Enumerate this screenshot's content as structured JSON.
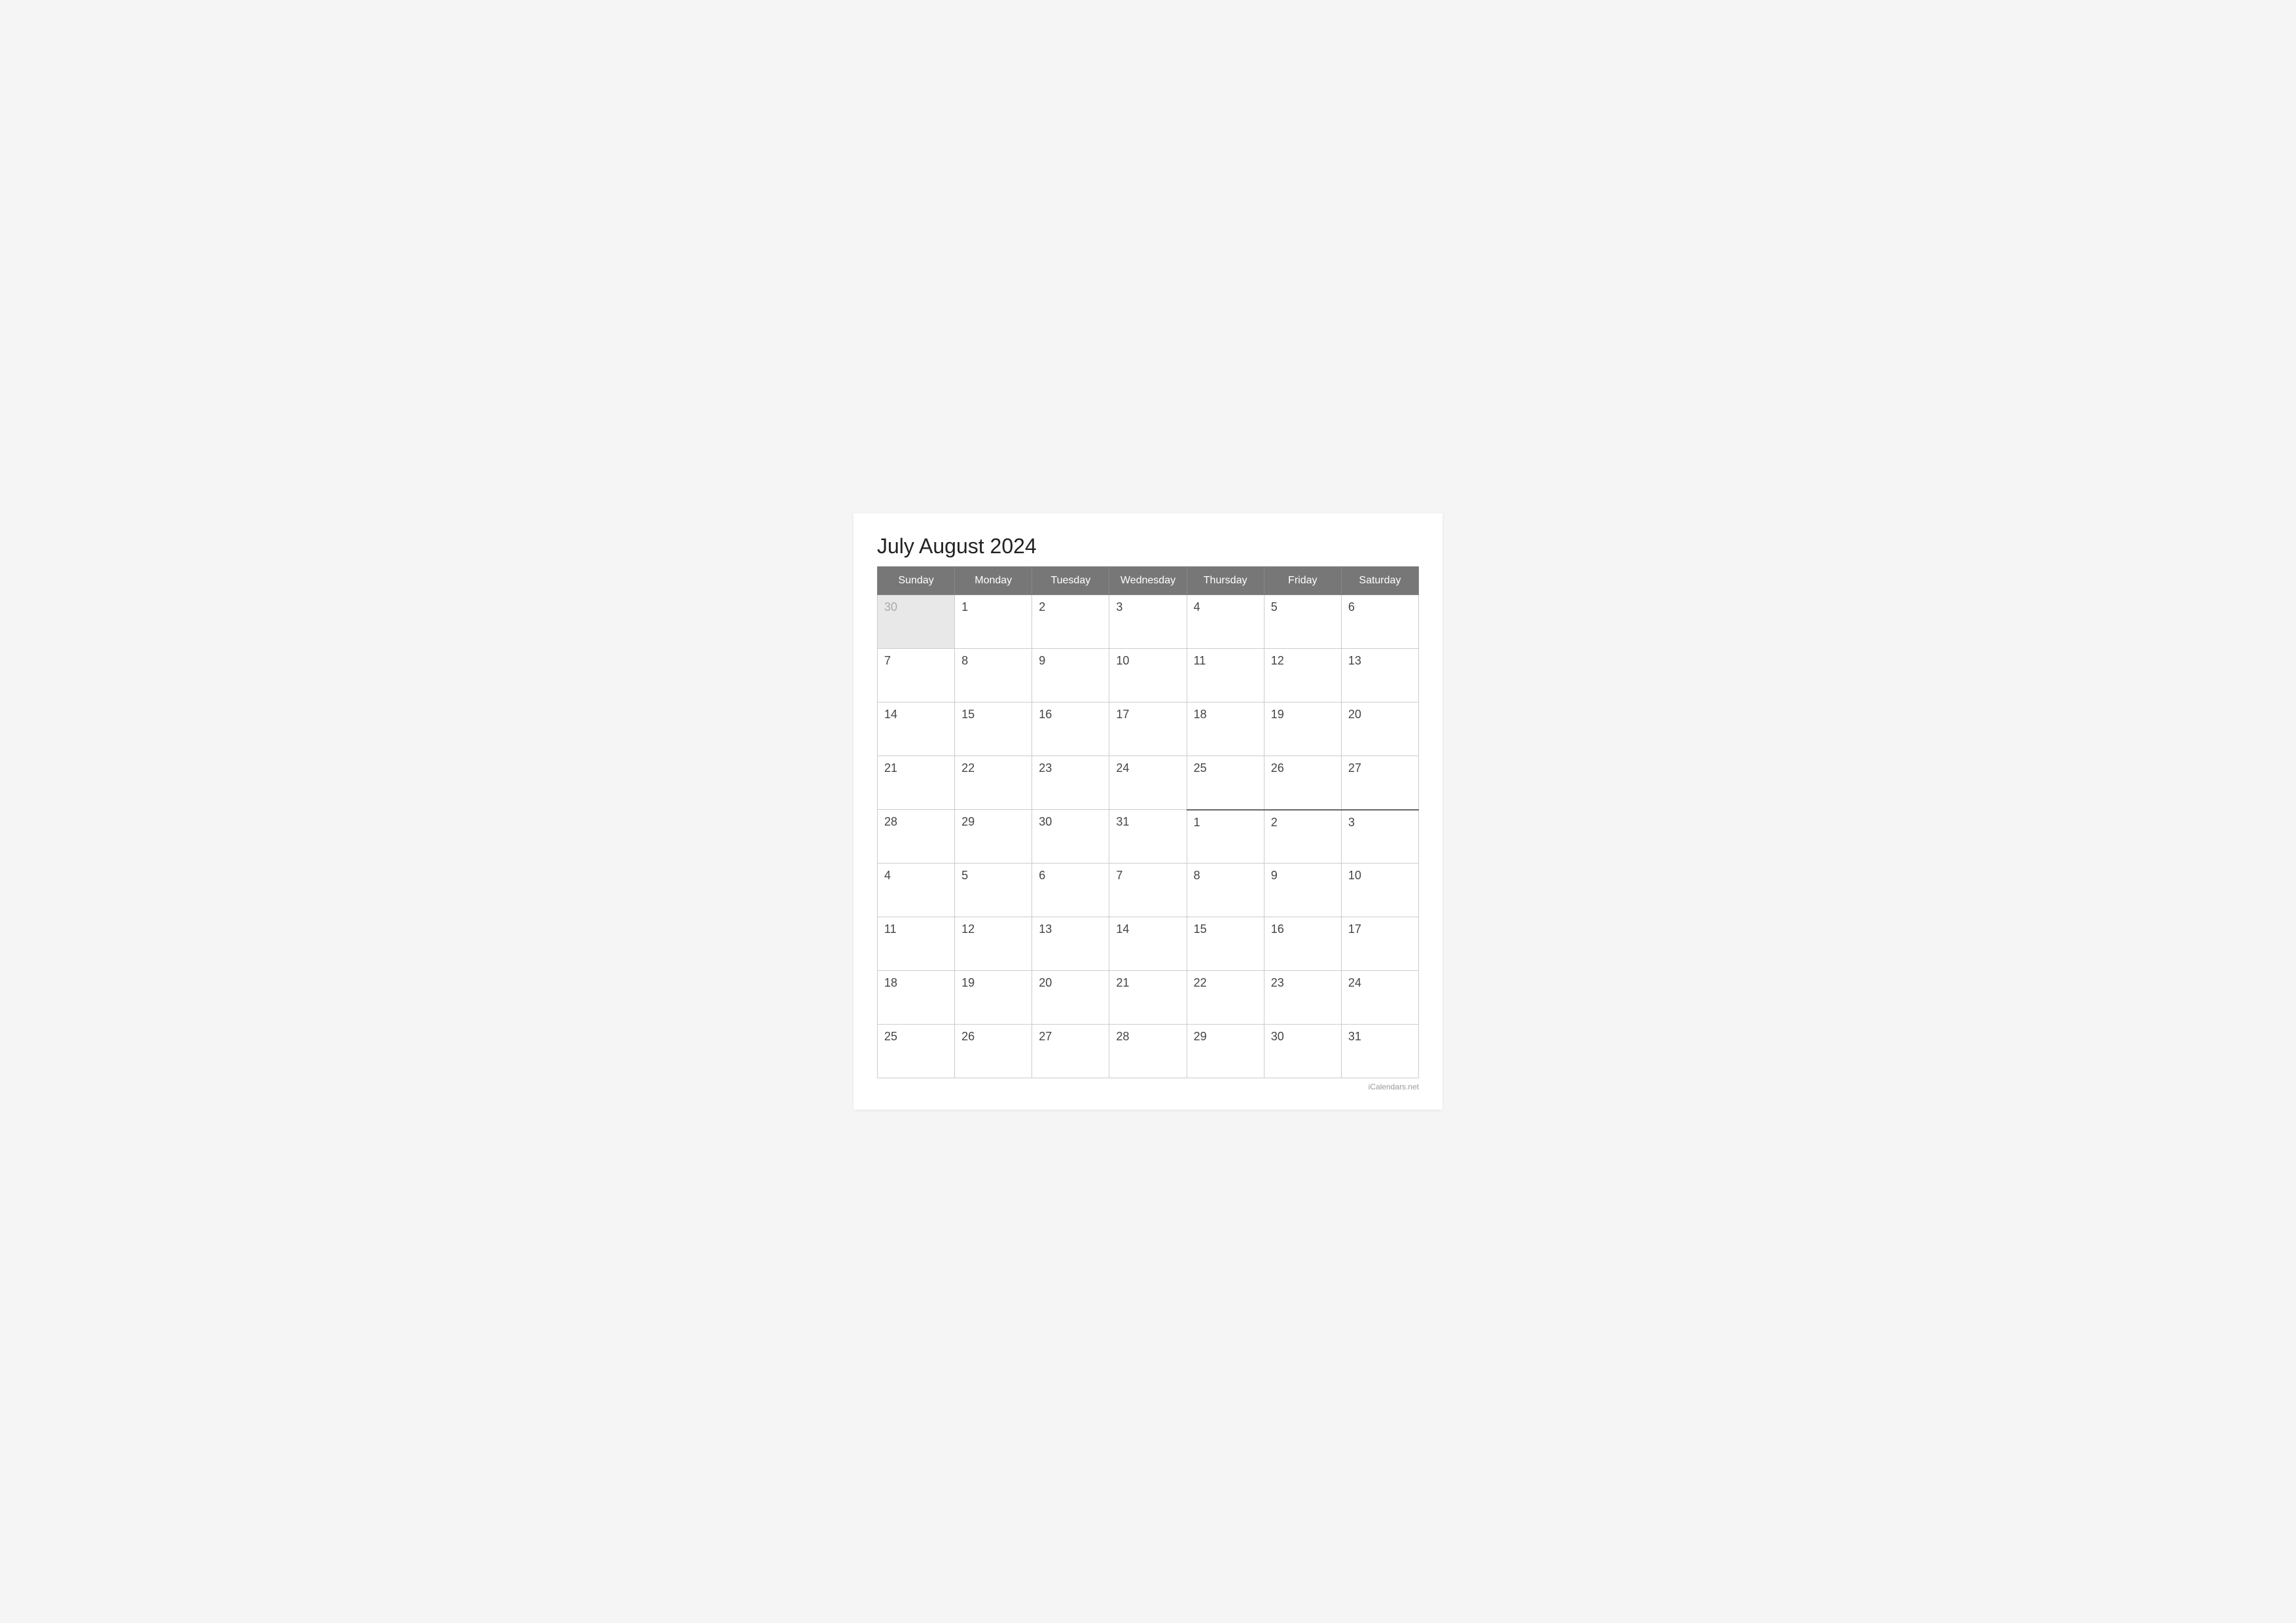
{
  "title": "July August 2024",
  "footer": "iCalendars.net",
  "header": {
    "days": [
      "Sunday",
      "Monday",
      "Tuesday",
      "Wednesday",
      "Thursday",
      "Friday",
      "Saturday"
    ]
  },
  "weeks": [
    {
      "cells": [
        {
          "day": "30",
          "otherMonth": true
        },
        {
          "day": "1",
          "otherMonth": false
        },
        {
          "day": "2",
          "otherMonth": false
        },
        {
          "day": "3",
          "otherMonth": false
        },
        {
          "day": "4",
          "otherMonth": false
        },
        {
          "day": "5",
          "otherMonth": false
        },
        {
          "day": "6",
          "otherMonth": false
        }
      ]
    },
    {
      "cells": [
        {
          "day": "7",
          "otherMonth": false
        },
        {
          "day": "8",
          "otherMonth": false
        },
        {
          "day": "9",
          "otherMonth": false
        },
        {
          "day": "10",
          "otherMonth": false
        },
        {
          "day": "11",
          "otherMonth": false
        },
        {
          "day": "12",
          "otherMonth": false
        },
        {
          "day": "13",
          "otherMonth": false
        }
      ]
    },
    {
      "cells": [
        {
          "day": "14",
          "otherMonth": false
        },
        {
          "day": "15",
          "otherMonth": false
        },
        {
          "day": "16",
          "otherMonth": false
        },
        {
          "day": "17",
          "otherMonth": false
        },
        {
          "day": "18",
          "otherMonth": false
        },
        {
          "day": "19",
          "otherMonth": false
        },
        {
          "day": "20",
          "otherMonth": false
        }
      ]
    },
    {
      "cells": [
        {
          "day": "21",
          "otherMonth": false
        },
        {
          "day": "22",
          "otherMonth": false
        },
        {
          "day": "23",
          "otherMonth": false
        },
        {
          "day": "24",
          "otherMonth": false
        },
        {
          "day": "25",
          "otherMonth": false
        },
        {
          "day": "26",
          "otherMonth": false
        },
        {
          "day": "27",
          "otherMonth": false
        }
      ]
    },
    {
      "cells": [
        {
          "day": "28",
          "otherMonth": false
        },
        {
          "day": "29",
          "otherMonth": false
        },
        {
          "day": "30",
          "otherMonth": false
        },
        {
          "day": "31",
          "otherMonth": false
        },
        {
          "day": "1",
          "otherMonth": false,
          "boundaryTop": true
        },
        {
          "day": "2",
          "otherMonth": false,
          "boundaryTop": true
        },
        {
          "day": "3",
          "otherMonth": false,
          "boundaryTop": true
        }
      ]
    },
    {
      "cells": [
        {
          "day": "4",
          "otherMonth": false
        },
        {
          "day": "5",
          "otherMonth": false
        },
        {
          "day": "6",
          "otherMonth": false
        },
        {
          "day": "7",
          "otherMonth": false
        },
        {
          "day": "8",
          "otherMonth": false
        },
        {
          "day": "9",
          "otherMonth": false
        },
        {
          "day": "10",
          "otherMonth": false
        }
      ]
    },
    {
      "cells": [
        {
          "day": "11",
          "otherMonth": false
        },
        {
          "day": "12",
          "otherMonth": false
        },
        {
          "day": "13",
          "otherMonth": false
        },
        {
          "day": "14",
          "otherMonth": false
        },
        {
          "day": "15",
          "otherMonth": false
        },
        {
          "day": "16",
          "otherMonth": false
        },
        {
          "day": "17",
          "otherMonth": false
        }
      ]
    },
    {
      "cells": [
        {
          "day": "18",
          "otherMonth": false
        },
        {
          "day": "19",
          "otherMonth": false
        },
        {
          "day": "20",
          "otherMonth": false
        },
        {
          "day": "21",
          "otherMonth": false
        },
        {
          "day": "22",
          "otherMonth": false
        },
        {
          "day": "23",
          "otherMonth": false
        },
        {
          "day": "24",
          "otherMonth": false
        }
      ]
    },
    {
      "cells": [
        {
          "day": "25",
          "otherMonth": false
        },
        {
          "day": "26",
          "otherMonth": false
        },
        {
          "day": "27",
          "otherMonth": false
        },
        {
          "day": "28",
          "otherMonth": false
        },
        {
          "day": "29",
          "otherMonth": false
        },
        {
          "day": "30",
          "otherMonth": false
        },
        {
          "day": "31",
          "otherMonth": false
        }
      ]
    }
  ]
}
